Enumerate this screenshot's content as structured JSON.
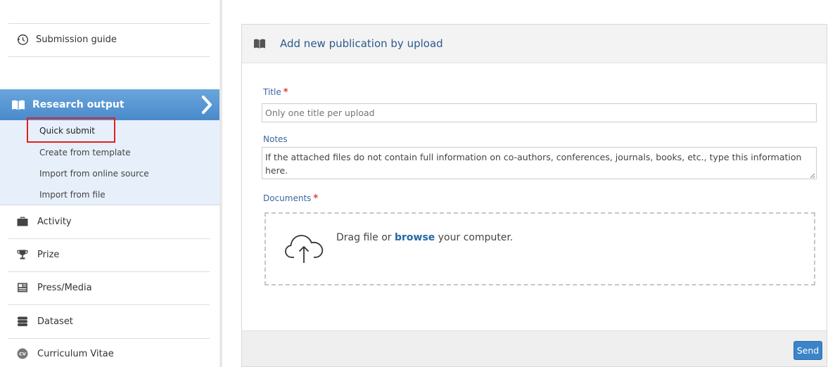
{
  "sidebar": {
    "guide_label": "Submission guide",
    "section_label": "Research output",
    "sub_items": [
      "Quick submit",
      "Create from template",
      "Import from online source",
      "Import from file"
    ],
    "nav": [
      {
        "label": "Activity",
        "icon": "briefcase-icon"
      },
      {
        "label": "Prize",
        "icon": "trophy-icon"
      },
      {
        "label": "Press/Media",
        "icon": "newspaper-icon"
      },
      {
        "label": "Dataset",
        "icon": "database-icon"
      },
      {
        "label": "Curriculum Vitae",
        "icon": "cv-icon"
      }
    ]
  },
  "panel": {
    "title": "Add new publication by upload",
    "title_field": {
      "label": "Title",
      "placeholder": "Only one title per upload"
    },
    "notes_field": {
      "label": "Notes",
      "placeholder": "If the attached files do not contain full information on co-authors, conferences, journals, books, etc., type this information here."
    },
    "documents": {
      "label": "Documents",
      "drop_prefix": "Drag file or",
      "browse_link": "browse",
      "drop_suffix": "your computer."
    },
    "required_mark": "*",
    "send_label": "Send"
  },
  "colors": {
    "accent": "#4a8acb",
    "highlight_border": "#e02020",
    "link": "#2468a6",
    "required": "#e03a3a"
  }
}
